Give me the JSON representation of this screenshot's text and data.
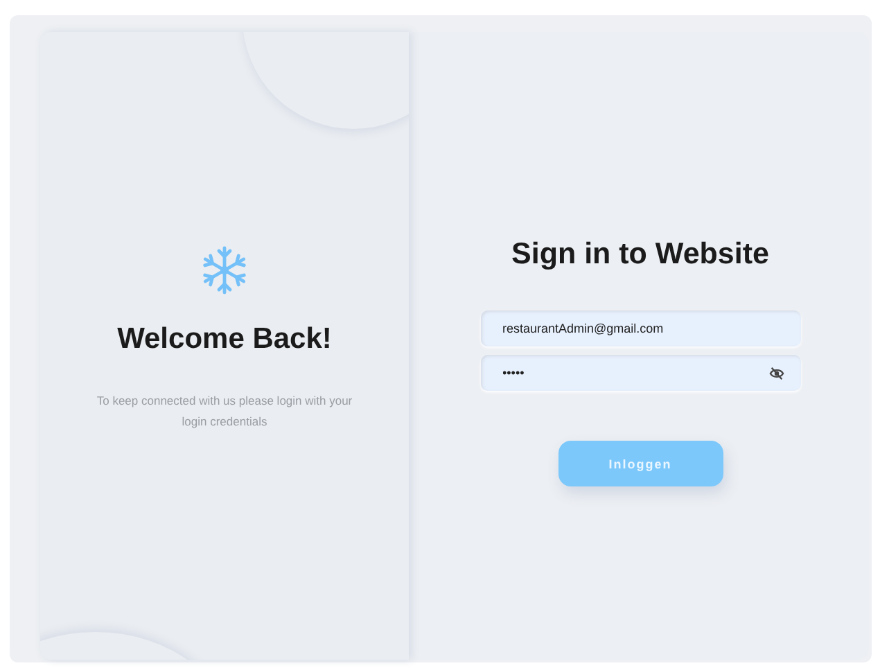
{
  "welcome": {
    "title": "Welcome Back!",
    "message": "To keep connected with us please login with your login credentials"
  },
  "signin": {
    "title": "Sign in to Website",
    "fields": [
      {
        "kind": "email",
        "value": "restaurantAdmin@gmail.com"
      },
      {
        "kind": "password",
        "value": "•••••",
        "reveal": false
      }
    ],
    "button": "Inloggen"
  }
}
